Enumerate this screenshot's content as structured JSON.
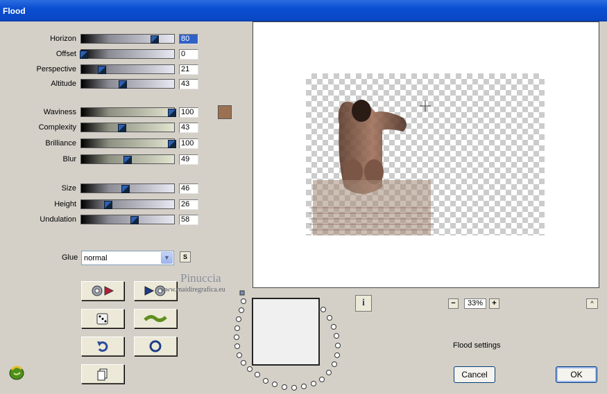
{
  "window": {
    "title": "Flood"
  },
  "sliders": [
    {
      "label": "Horizon",
      "value": "80",
      "level": 0.78
    },
    {
      "label": "Offset",
      "value": "0",
      "level": 0.02
    },
    {
      "label": "Perspective",
      "value": "21",
      "level": 0.22
    },
    {
      "label": "Altitude",
      "value": "43",
      "level": 0.44
    },
    {
      "label": "Waviness",
      "value": "100",
      "level": 0.97
    },
    {
      "label": "Complexity",
      "value": "43",
      "level": 0.43
    },
    {
      "label": "Brilliance",
      "value": "100",
      "level": 0.97
    },
    {
      "label": "Blur",
      "value": "49",
      "level": 0.49
    },
    {
      "label": "Size",
      "value": "46",
      "level": 0.47
    },
    {
      "label": "Height",
      "value": "26",
      "level": 0.28
    },
    {
      "label": "Undulation",
      "value": "58",
      "level": 0.57
    }
  ],
  "color_swatch": "#9b7152",
  "glue": {
    "label": "Glue",
    "value": "normal",
    "s_button": "S"
  },
  "tool_buttons": [
    "randomize-forward-icon",
    "preset-play-icon",
    "dice-icon",
    "wave-icon",
    "undo-icon",
    "reset-icon",
    "copy-icon"
  ],
  "watermark": {
    "name": "Pinuccia",
    "url": "www.maidiregrafica.eu"
  },
  "info_button": "i",
  "zoom": {
    "minus": "−",
    "value": "33%",
    "plus": "+"
  },
  "collapse_button": "^",
  "settings_label": "Flood settings",
  "buttons": {
    "cancel": "Cancel",
    "ok": "OK"
  }
}
